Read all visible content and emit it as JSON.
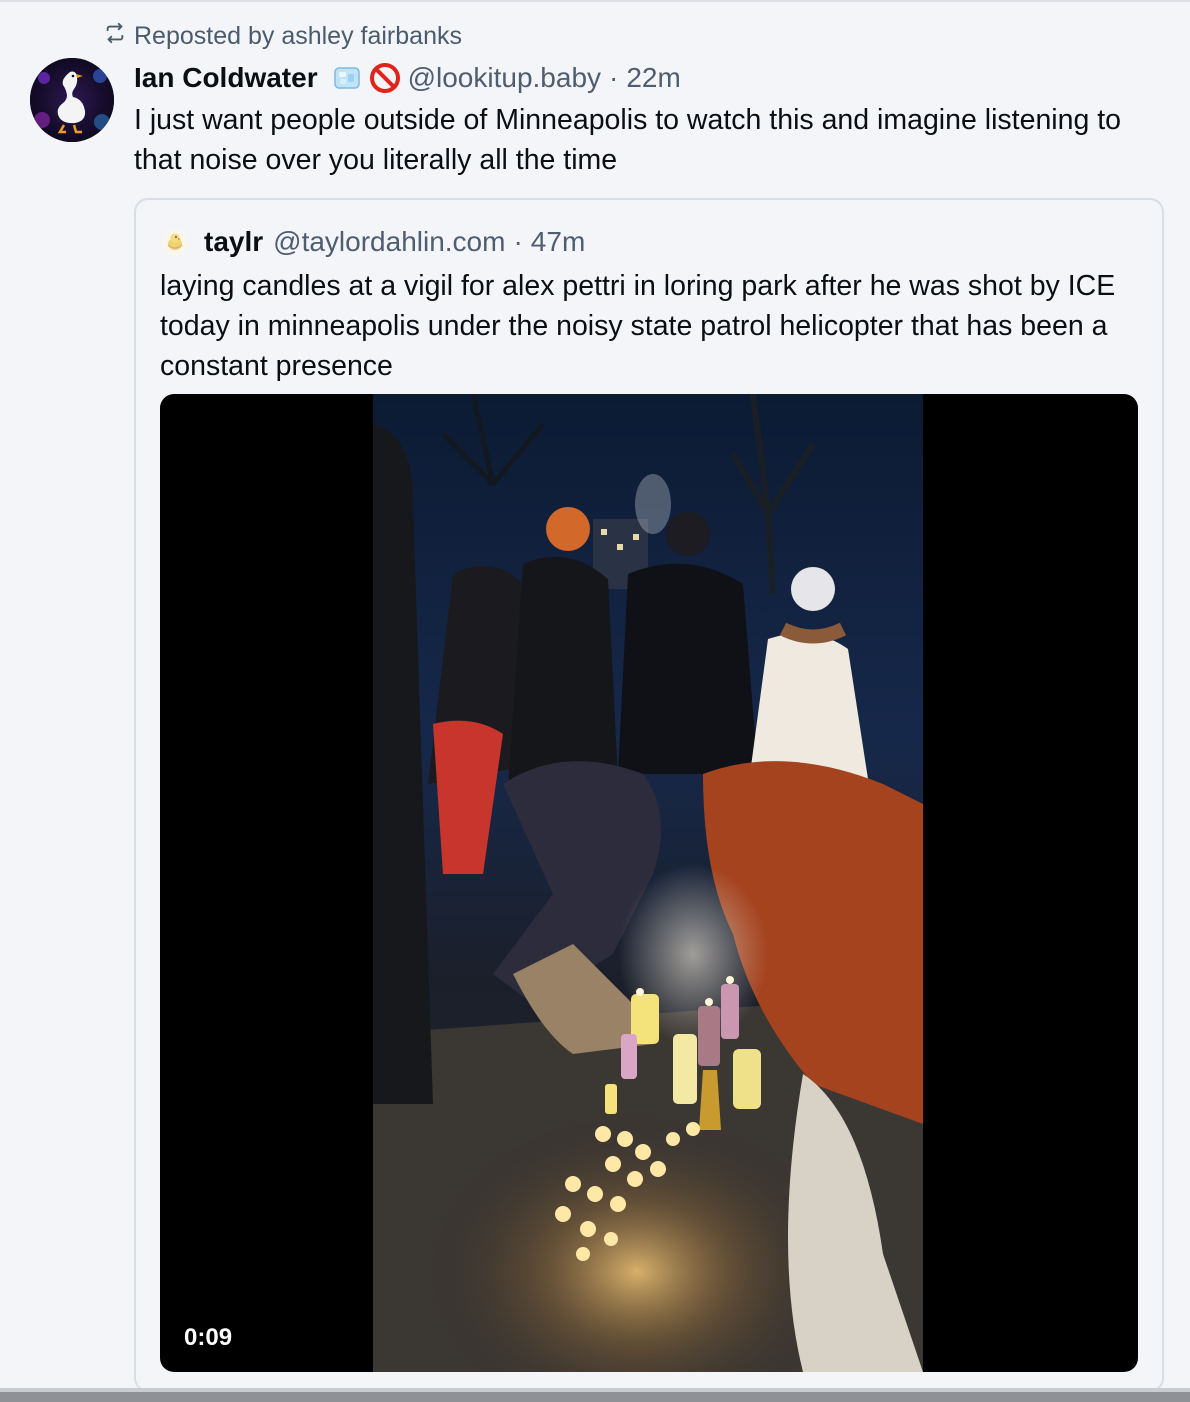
{
  "repost": {
    "icon": "repost-icon",
    "label": "Reposted by ashley fairbanks"
  },
  "post": {
    "author_name": "Ian Coldwater",
    "name_emojis": [
      "ice-cube-icon",
      "prohibited-icon"
    ],
    "handle": "@lookitup.baby",
    "separator": "·",
    "time": "22m",
    "text": "I just want people outside of Minneapolis to watch this and imagine listening to that noise over you literally all the time",
    "avatar": "goose-avatar"
  },
  "quote": {
    "author_name": "taylr",
    "handle": "@taylordahlin.com",
    "separator": "·",
    "time": "47m",
    "text": "laying candles at a vigil for alex pettri in loring park after he was shot by ICE today in minneapolis under the noisy state patrol helicopter that has been a constant presence",
    "avatar": "chick-avatar",
    "video": {
      "duration": "0:09",
      "content": "candlelight-vigil-video"
    }
  },
  "colors": {
    "background": "#f3f5f8",
    "text": "#0b0f14",
    "muted": "#4f5d70",
    "border": "#d9dee5"
  }
}
